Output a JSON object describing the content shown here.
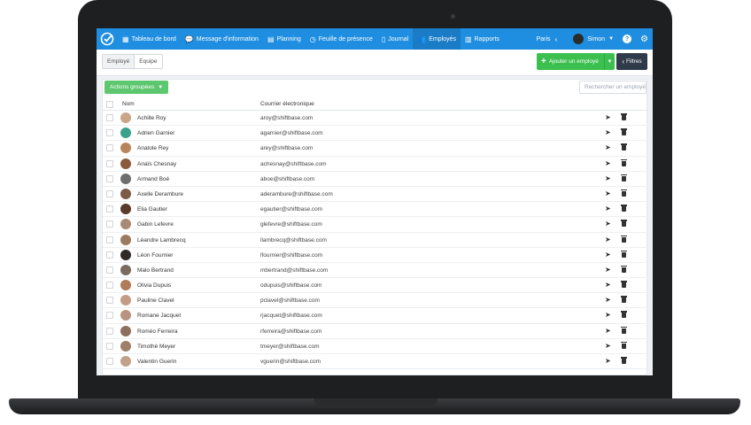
{
  "nav": {
    "items": [
      {
        "label": "Tableau de bord",
        "icon": "dashboard-icon",
        "glyph": "▦"
      },
      {
        "label": "Message d'information",
        "icon": "chat-icon",
        "glyph": "💬"
      },
      {
        "label": "Planning",
        "icon": "calendar-icon",
        "glyph": "▤"
      },
      {
        "label": "Feuille de présence",
        "icon": "clock-icon",
        "glyph": "◷"
      },
      {
        "label": "Journal",
        "icon": "journal-icon",
        "glyph": "▯"
      },
      {
        "label": "Employés",
        "icon": "people-icon",
        "glyph": "👥"
      },
      {
        "label": "Rapports",
        "icon": "bar-chart-icon",
        "glyph": "▥"
      }
    ],
    "active": "Employés",
    "location": "Paris",
    "user": "Simon"
  },
  "toolbar": {
    "tab_employee": "Employé",
    "tab_team": "Equipe",
    "add_label": "Ajouter un employé",
    "filters_label": "Filtres"
  },
  "table": {
    "bulk_label": "Actions groupées",
    "search_placeholder": "Rechercher un employé",
    "col_name": "Nom",
    "col_email": "Courrier électronique",
    "rows": [
      {
        "name": "Achille Roy",
        "email": "aroy@shiftbase.com",
        "avatar": "#c9a58a"
      },
      {
        "name": "Adrien Garnier",
        "email": "agarnier@shiftbase.com",
        "avatar": "#3aa18a"
      },
      {
        "name": "Anatole Rey",
        "email": "arey@shiftbase.com",
        "avatar": "#b8845e"
      },
      {
        "name": "Anaïs Chesnay",
        "email": "achesnay@shiftbase.com",
        "avatar": "#8a5a3c"
      },
      {
        "name": "Armand Boé",
        "email": "aboe@shiftbase.com",
        "avatar": "#6e6e6e"
      },
      {
        "name": "Axelle Derambure",
        "email": "aderambure@shiftbase.com",
        "avatar": "#7a5b48"
      },
      {
        "name": "Elia Gautier",
        "email": "egautier@shiftbase.com",
        "avatar": "#5a3a2a"
      },
      {
        "name": "Gabin Lefevre",
        "email": "glefevre@shiftbase.com",
        "avatar": "#a88a74"
      },
      {
        "name": "Léandre Lambrecq",
        "email": "llambrecq@shiftbase.com",
        "avatar": "#9c7a62"
      },
      {
        "name": "Léon Fournier",
        "email": "lfournier@shiftbase.com",
        "avatar": "#2f2a28"
      },
      {
        "name": "Malo Bertrand",
        "email": "mbertrand@shiftbase.com",
        "avatar": "#7b6a5e"
      },
      {
        "name": "Olivia Dupuis",
        "email": "odupuis@shiftbase.com",
        "avatar": "#b07c5a"
      },
      {
        "name": "Pauline Clavel",
        "email": "pclavel@shiftbase.com",
        "avatar": "#c49c84"
      },
      {
        "name": "Romane Jacquet",
        "email": "rjacquet@shiftbase.com",
        "avatar": "#b89480"
      },
      {
        "name": "Roméo Ferreira",
        "email": "rferreira@shiftbase.com",
        "avatar": "#8e6e5c"
      },
      {
        "name": "Timothé Meyer",
        "email": "tmeyer@shiftbase.com",
        "avatar": "#a07e68"
      },
      {
        "name": "Valentin Guerin",
        "email": "vguerin@shiftbase.com",
        "avatar": "#c2a08a"
      }
    ]
  },
  "colors": {
    "nav_bg": "#1f8ee0",
    "nav_active": "#1a7cc7",
    "add_button": "#3bbf4f",
    "filters_button": "#2f3a4a",
    "bulk_button": "#5cc76e"
  }
}
